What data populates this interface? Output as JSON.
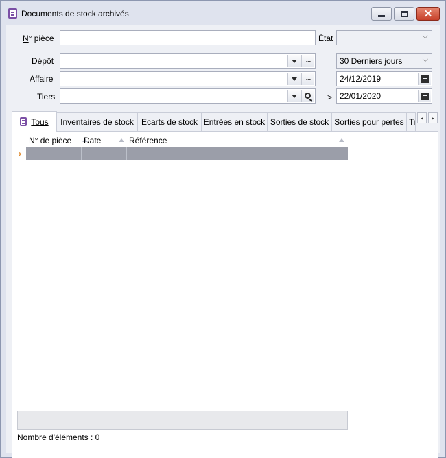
{
  "window": {
    "title": "Documents de stock archivés"
  },
  "form": {
    "num_piece_label": "N° pièce",
    "num_piece_value": "",
    "etat_label": "État",
    "etat_value": "",
    "depot_label": "Dépôt",
    "depot_value": "",
    "affaire_label": "Affaire",
    "affaire_value": "",
    "tiers_label": "Tiers",
    "tiers_value": "",
    "period_value": "30 Derniers jours",
    "date_from": "24/12/2019",
    "date_to_prefix": ">",
    "date_to": "22/01/2020"
  },
  "tabs": [
    {
      "label": "Tous",
      "active": true
    },
    {
      "label": "Inventaires de stock",
      "active": false
    },
    {
      "label": "Ecarts de stock",
      "active": false
    },
    {
      "label": "Entrées en stock",
      "active": false
    },
    {
      "label": "Sorties de stock",
      "active": false
    },
    {
      "label": "Sorties pour pertes",
      "active": false
    },
    {
      "label": "Tı",
      "active": false
    }
  ],
  "grid": {
    "columns": [
      "N° de pièce",
      "Date",
      "Référence"
    ],
    "row_indicator": "›",
    "rows": []
  },
  "status": {
    "count_text": "Nombre d'éléments : 0"
  },
  "icons": {
    "app": "document-stock-icon",
    "minimize": "minimize-icon",
    "maximize": "maximize-icon",
    "close": "close-icon"
  }
}
